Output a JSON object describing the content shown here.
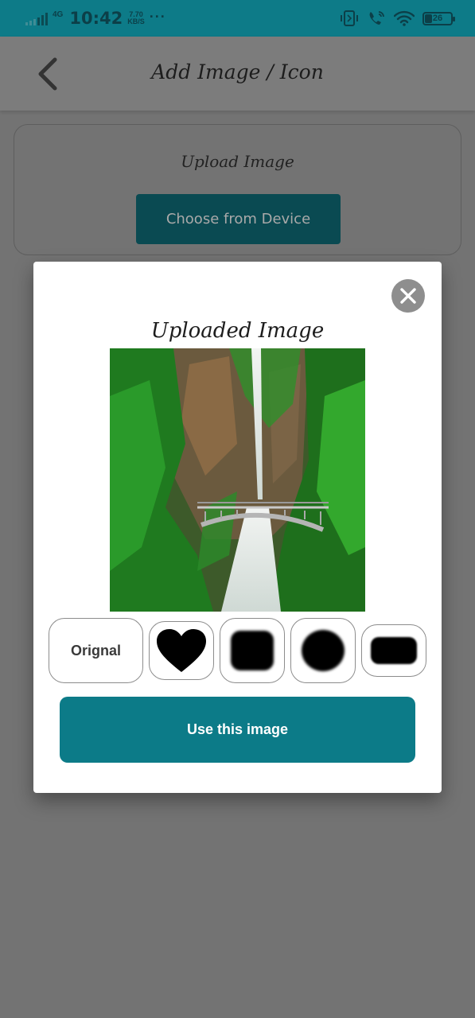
{
  "status_bar": {
    "network": "4G",
    "time": "10:42",
    "speed_value": "7.70",
    "speed_unit": "KB/S",
    "overflow": "···",
    "battery_level": "26",
    "icons": [
      "signal-icon",
      "bluetooth-vibrate-icon",
      "wifi-calling-icon",
      "wifi-icon",
      "battery-icon"
    ]
  },
  "header": {
    "back_icon": "chevron-left-icon",
    "title": "Add Image / Icon"
  },
  "upload_card": {
    "label": "Upload Image",
    "button_label": "Choose from Device"
  },
  "dialog": {
    "close_icon": "close-icon",
    "title": "Uploaded Image",
    "image_description": "waterfall-with-bridge",
    "shape_options": [
      {
        "id": "original",
        "label": "Orignal"
      },
      {
        "id": "heart",
        "icon": "heart-icon"
      },
      {
        "id": "rounded-square",
        "icon": "rounded-square-icon"
      },
      {
        "id": "circle",
        "icon": "circle-icon"
      },
      {
        "id": "rounded-rectangle",
        "icon": "rounded-rectangle-icon"
      }
    ],
    "use_button_label": "Use this image"
  },
  "colors": {
    "accent": "#0c7b88",
    "accent_dark": "#0a4a52",
    "overlay": "#737373"
  }
}
